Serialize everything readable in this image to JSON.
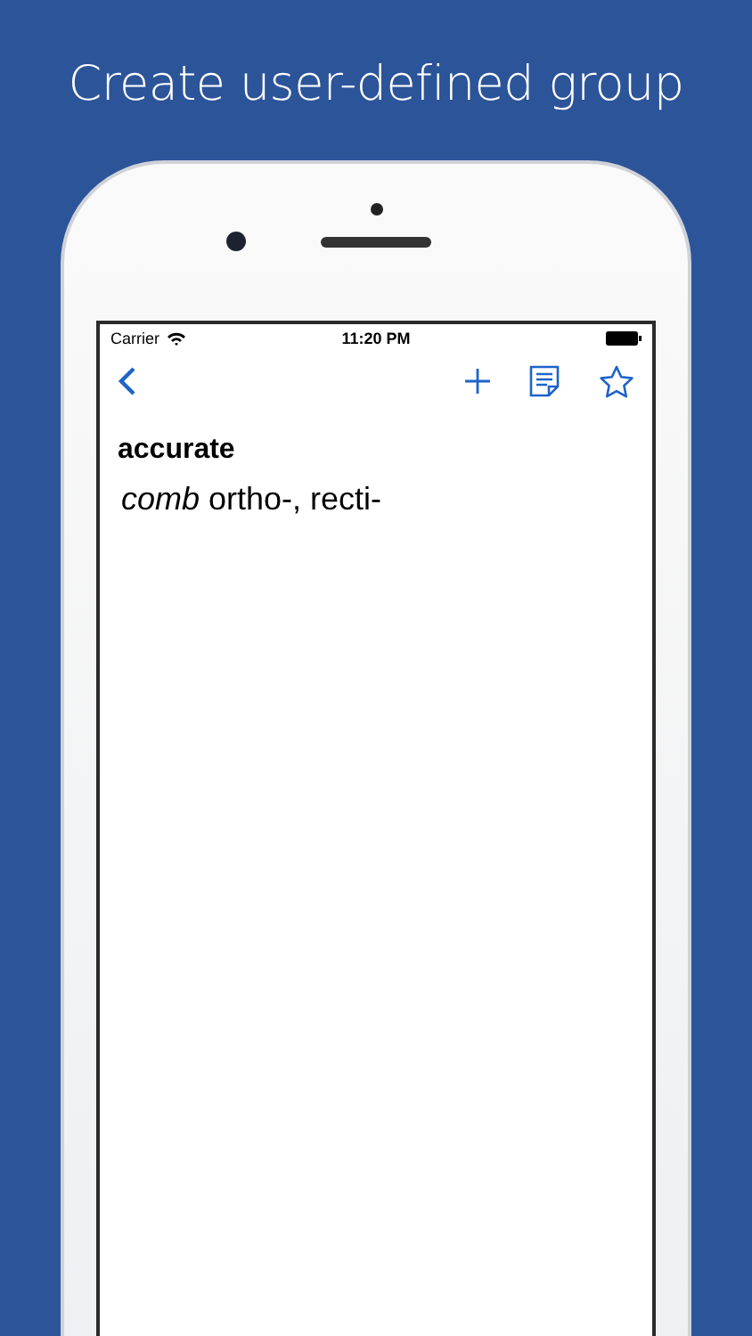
{
  "headline": "Create user-defined group",
  "status_bar": {
    "carrier": "Carrier",
    "time": "11:20 PM"
  },
  "entry": {
    "headword": "accurate",
    "definition": "*comb* ortho-, recti-"
  }
}
